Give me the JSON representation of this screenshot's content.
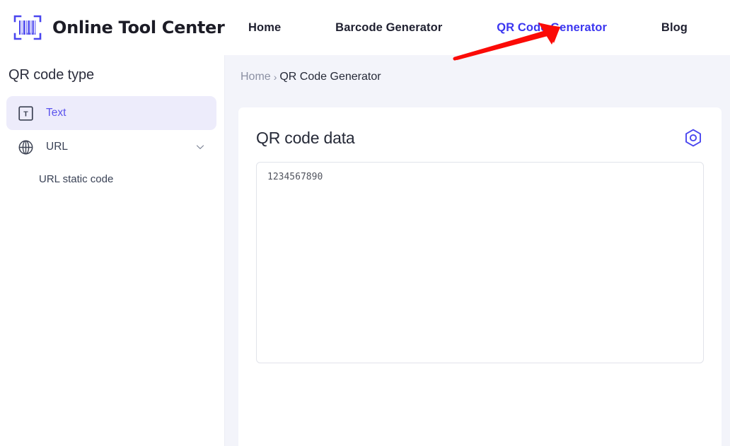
{
  "header": {
    "brand_name": "Online Tool Center",
    "logo_icon": "barcode-scan-icon",
    "nav": [
      {
        "label": "Home",
        "active": false
      },
      {
        "label": "Barcode Generator",
        "active": false
      },
      {
        "label": "QR Code Generator",
        "active": true
      },
      {
        "label": "Blog",
        "active": false
      }
    ],
    "annotation": {
      "type": "red-arrow",
      "color": "#fb0b07",
      "points_to": "QR Code Generator"
    }
  },
  "sidebar": {
    "title": "QR code type",
    "items": [
      {
        "label": "Text",
        "icon": "text-box-icon",
        "active": true,
        "expandable": false
      },
      {
        "label": "URL",
        "icon": "globe-icon",
        "active": false,
        "expandable": true
      }
    ],
    "subitems": [
      {
        "label": "URL static code"
      }
    ]
  },
  "breadcrumb": {
    "home": "Home",
    "separator": "›",
    "current": "QR Code Generator"
  },
  "main": {
    "card_title": "QR code data",
    "settings_icon": "hexagon-target-icon",
    "data_value": "1234567890",
    "data_placeholder": ""
  },
  "colors": {
    "accent": "#3b36f0",
    "accent_soft": "#5b53ed",
    "active_pill": "#edecfb",
    "content_bg": "#f3f4fa",
    "annotation_red": "#fb0b07",
    "text_dark": "#262a38",
    "text_muted": "#8b90a3"
  }
}
